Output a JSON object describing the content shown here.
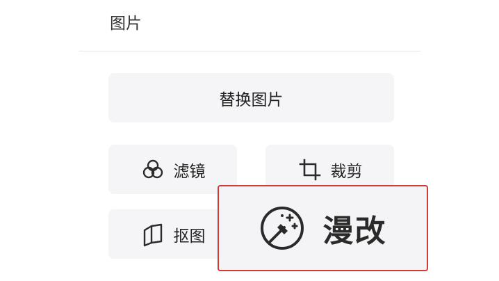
{
  "section": {
    "title": "图片"
  },
  "buttons": {
    "replace_label": "替换图片",
    "filter_label": "滤镜",
    "crop_label": "裁剪",
    "cutout_label": "抠图",
    "comic_label": "漫改"
  },
  "icons": {
    "filter": "filter-circles-icon",
    "crop": "crop-icon",
    "cutout": "cutout-icon",
    "comic": "magic-wand-icon"
  },
  "colors": {
    "highlight_border": "#d23a3a",
    "button_bg": "#f5f5f7",
    "text": "#222222"
  }
}
